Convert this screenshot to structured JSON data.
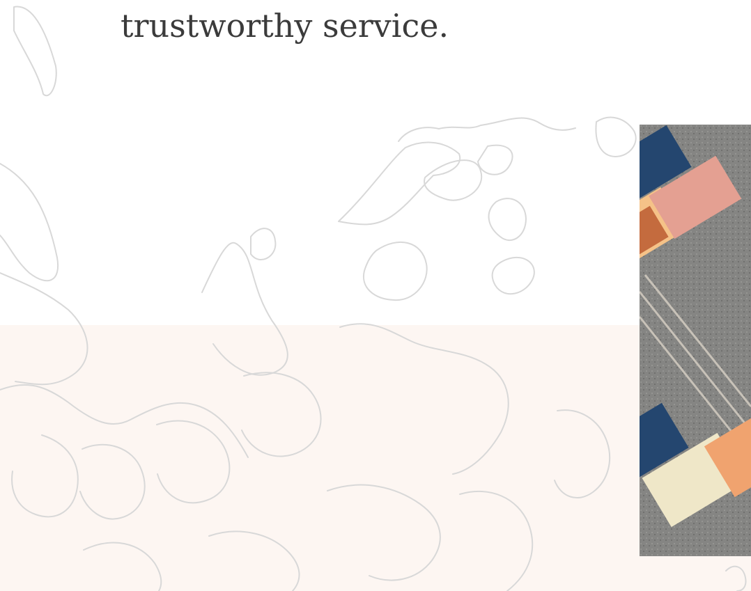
{
  "hero": {
    "text_line": "trustworthy service."
  },
  "media": {
    "map_icon": "world-map-outline",
    "photo_icon": "container-train-photo"
  },
  "colors": {
    "background": "#ffffff",
    "band": "#fdf6f2",
    "text": "#3b3b3b",
    "map_stroke": "#d8d8d8",
    "container_orange": "#f0a36f",
    "container_blue": "#24466f",
    "container_pink": "#e4a092",
    "container_cream": "#efe7c8"
  }
}
